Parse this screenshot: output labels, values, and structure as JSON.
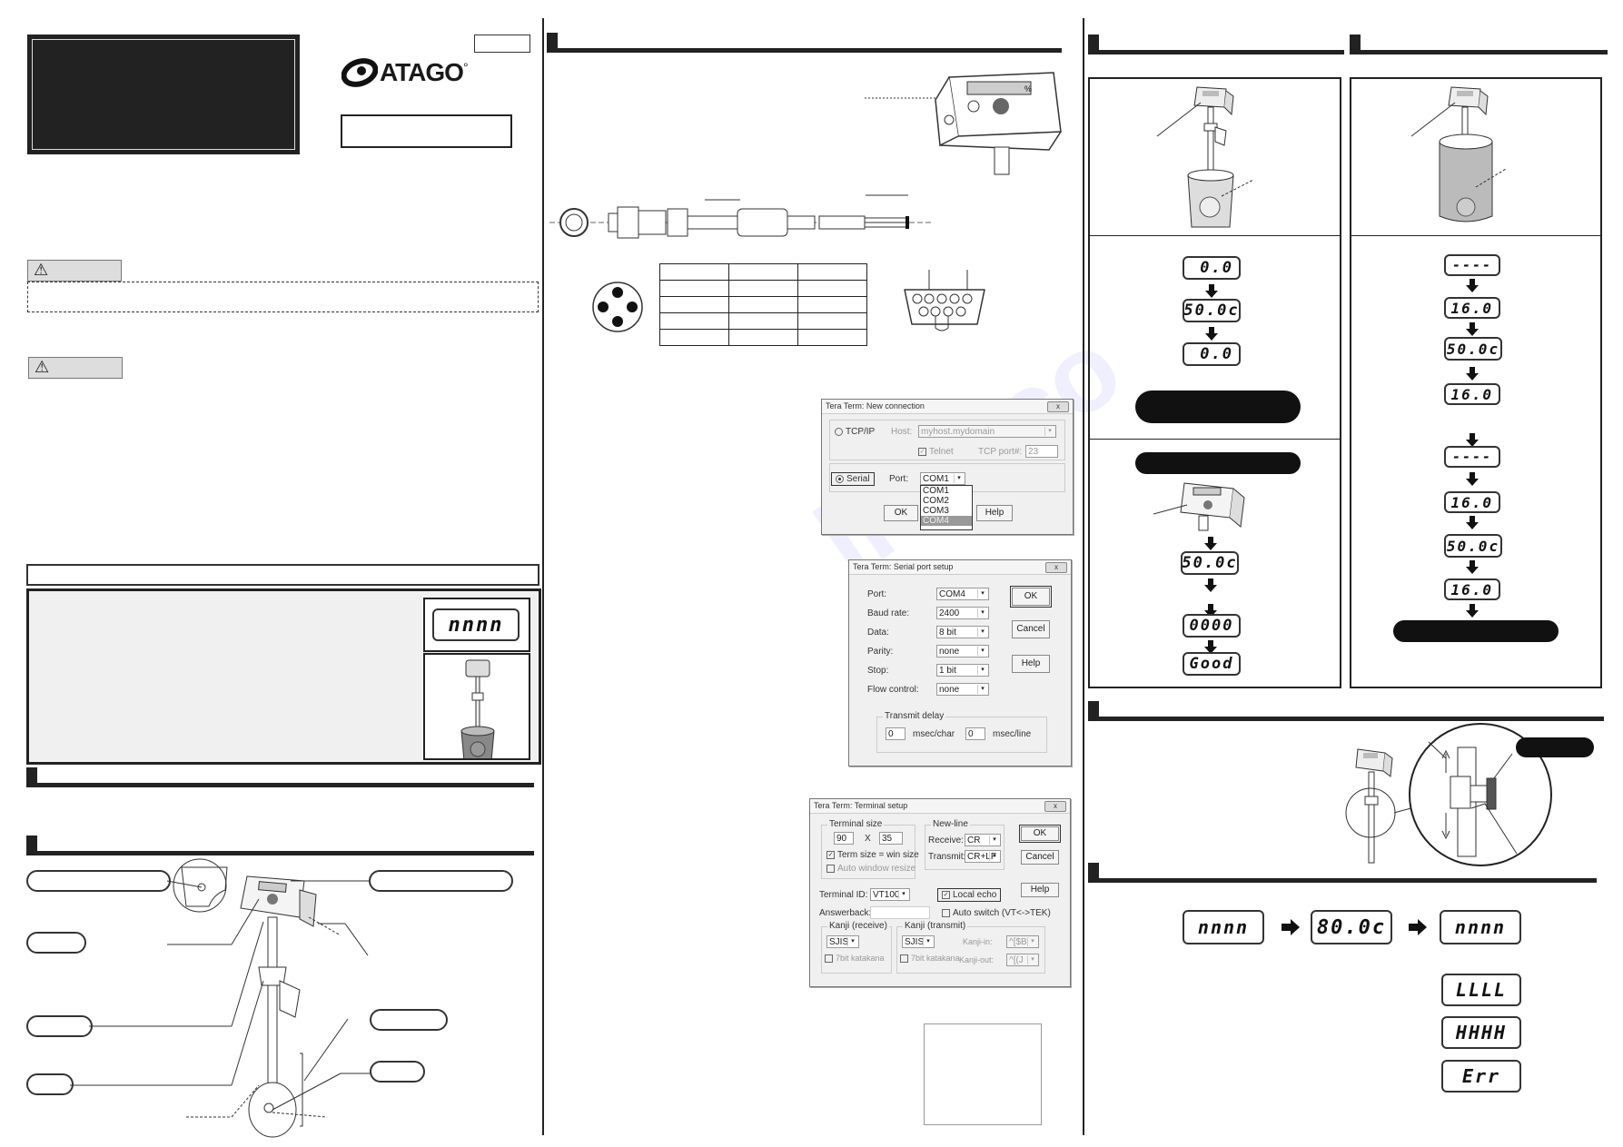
{
  "document": {
    "brand": "ATAGO",
    "brand_mark": "°",
    "model_badge": "",
    "title_box": "",
    "caution_badges": [
      "⚠",
      "⚠"
    ]
  },
  "dialogs": {
    "new_connection": {
      "title": "Tera Term: New connection",
      "close": "x",
      "tcpip_label": "TCP/IP",
      "host_label": "Host:",
      "host_value": "myhost.mydomain",
      "telnet_label": "Telnet",
      "tcp_port_label": "TCP port#:",
      "tcp_port_value": "23",
      "serial_label": "Serial",
      "port_label": "Port:",
      "port_value": "COM1",
      "port_options": [
        "COM1",
        "COM2",
        "COM3",
        "COM4"
      ],
      "highlighted_option": "COM4",
      "ok": "OK",
      "help": "Help"
    },
    "serial_setup": {
      "title": "Tera Term: Serial port setup",
      "close": "x",
      "fields": [
        {
          "label": "Port:",
          "value": "COM4"
        },
        {
          "label": "Baud rate:",
          "value": "2400"
        },
        {
          "label": "Data:",
          "value": "8 bit"
        },
        {
          "label": "Parity:",
          "value": "none"
        },
        {
          "label": "Stop:",
          "value": "1 bit"
        },
        {
          "label": "Flow control:",
          "value": "none"
        }
      ],
      "transmit_delay_label": "Transmit delay",
      "char_delay_value": "0",
      "char_delay_unit": "msec/char",
      "line_delay_value": "0",
      "line_delay_unit": "msec/line",
      "ok": "OK",
      "cancel": "Cancel",
      "help": "Help"
    },
    "terminal_setup": {
      "title": "Tera Term: Terminal setup",
      "close": "x",
      "terminal_size_label": "Terminal size",
      "cols": "90",
      "x_label": "X",
      "rows": "35",
      "term_size_win_label": "Term size = win size",
      "auto_resize_label": "Auto window resize",
      "newline_label": "New-line",
      "receive_label": "Receive:",
      "receive_value": "CR",
      "transmit_label": "Transmit:",
      "transmit_value": "CR+LF",
      "terminal_id_label": "Terminal ID:",
      "terminal_id_value": "VT100",
      "local_echo_label": "Local echo",
      "answerback_label": "Answerback:",
      "answerback_value": "",
      "auto_switch_label": "Auto switch (VT<->TEK)",
      "kanji_receive_label": "Kanji (receive)",
      "kanji_receive_value": "SJIS",
      "kanji_transmit_label": "Kanji (transmit)",
      "kanji_transmit_value": "SJIS",
      "katakana_label": "7bit katakana",
      "kanji_in_label": "Kanji-in:",
      "kanji_in_value": "^[$B",
      "kanji_out_label": "Kanji-out:",
      "kanji_out_value": "^[(J",
      "ok": "OK",
      "cancel": "Cancel",
      "help": "Help"
    }
  },
  "lcd_displays": {
    "intro": "nnnn",
    "zero_cal": [
      "0.0",
      "50.0c",
      "0.0"
    ],
    "zero_cal_check": [
      "50.0c",
      "0000",
      "Good"
    ],
    "sample": [
      "----",
      "16.0",
      "50.0c",
      "16.0",
      "----",
      "16.0",
      "50.0c",
      "16.0"
    ],
    "temp_sequence": [
      "nnnn",
      "80.0c",
      "nnnn"
    ],
    "errors": [
      "LLLL",
      "HHHH",
      "Err"
    ]
  },
  "device_label": "%"
}
